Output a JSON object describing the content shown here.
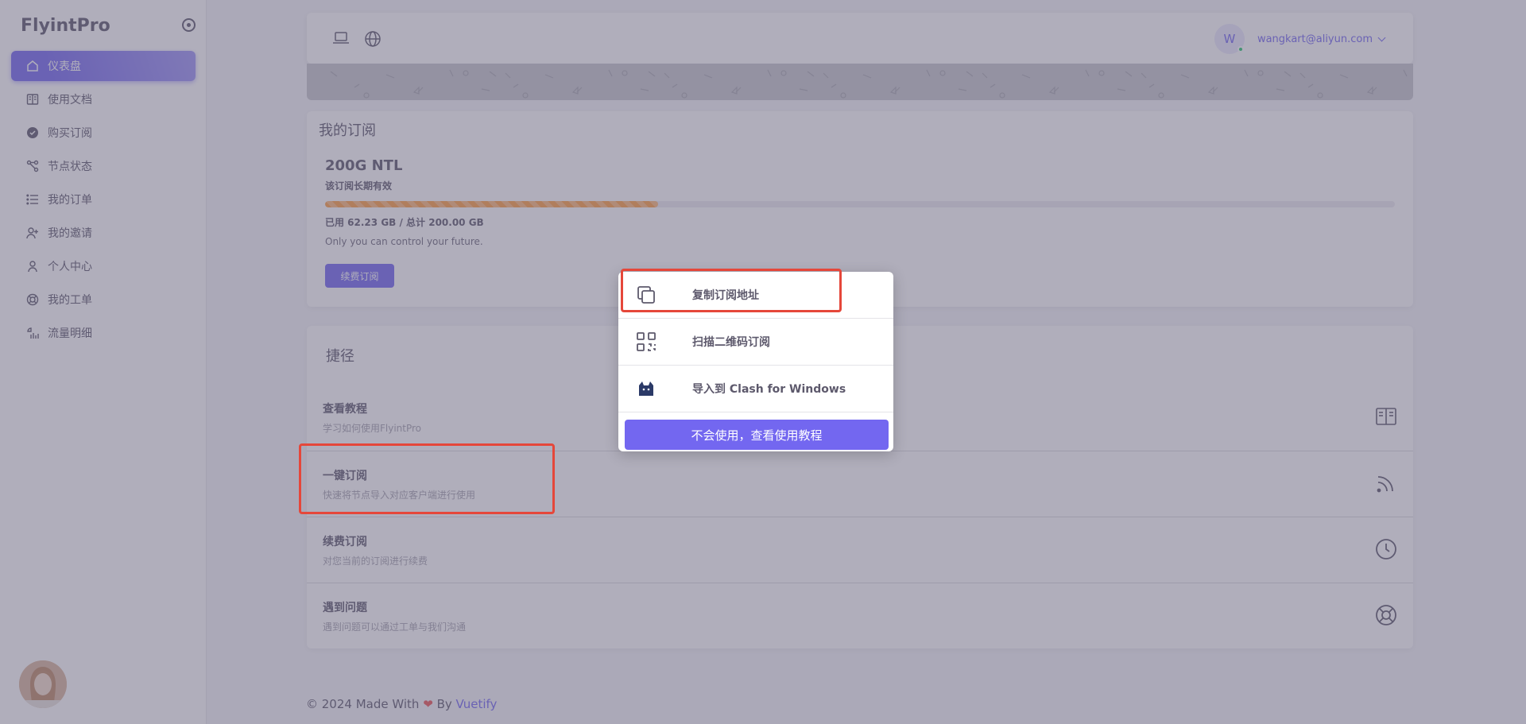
{
  "brand": {
    "name": "FlyintPro"
  },
  "sidebar": {
    "items": [
      {
        "label": "仪表盘",
        "icon": "home-icon",
        "active": true
      },
      {
        "label": "使用文档",
        "icon": "book-icon"
      },
      {
        "label": "购买订阅",
        "icon": "badge-check-icon"
      },
      {
        "label": "节点状态",
        "icon": "nodes-icon"
      },
      {
        "label": "我的订单",
        "icon": "list-icon"
      },
      {
        "label": "我的邀请",
        "icon": "user-plus-icon"
      },
      {
        "label": "个人中心",
        "icon": "user-icon"
      },
      {
        "label": "我的工单",
        "icon": "lifebuoy-icon"
      },
      {
        "label": "流量明细",
        "icon": "chart-icon"
      }
    ]
  },
  "header": {
    "user_initial": "W",
    "user_email": "wangkart@aliyun.com"
  },
  "subscription": {
    "title": "我的订阅",
    "plan_name": "200G NTL",
    "validity": "该订阅长期有效",
    "usage_text": "已用 62.23 GB / 总计 200.00 GB",
    "usage_fraction": 0.311,
    "motto": "Only you can control your future.",
    "renew_label": "续费订阅"
  },
  "shortcuts": {
    "title": "捷径",
    "items": [
      {
        "title": "查看教程",
        "desc": "学习如何使用FlyintPro",
        "icon": "book-open-icon"
      },
      {
        "title": "一键订阅",
        "desc": "快速将节点导入对应客户端进行使用",
        "icon": "rss-icon"
      },
      {
        "title": "续费订阅",
        "desc": "对您当前的订阅进行续费",
        "icon": "clock-icon"
      },
      {
        "title": "遇到问题",
        "desc": "遇到问题可以通过工单与我们沟通",
        "icon": "lifebuoy-icon"
      }
    ]
  },
  "dialog": {
    "items": [
      {
        "label": "复制订阅地址",
        "icon": "copy-icon"
      },
      {
        "label": "扫描二维码订阅",
        "icon": "qrcode-icon"
      },
      {
        "label": "导入到 Clash for Windows",
        "icon": "clash-cat-icon"
      }
    ],
    "help_button": "不会使用，查看使用教程"
  },
  "footer": {
    "prefix": "© 2024 Made With",
    "by": "By",
    "link": "Vuetify"
  },
  "colors": {
    "accent": "#7367f0",
    "highlight": "#e5473a",
    "progress": "#ff9f43"
  }
}
